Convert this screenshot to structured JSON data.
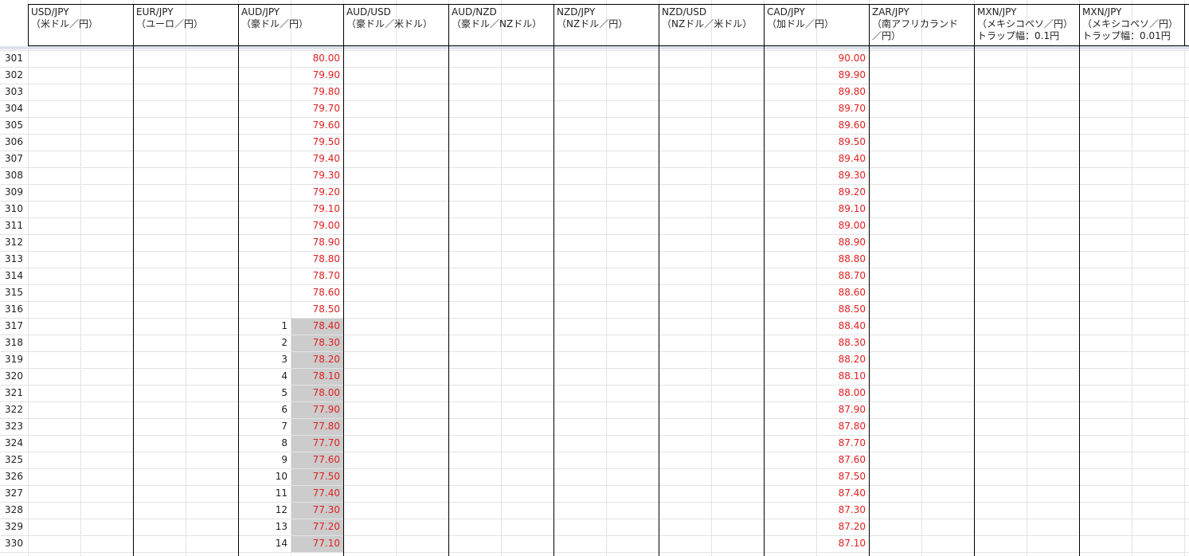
{
  "sheet": {
    "column_headers": [
      {
        "line1": "USD/JPY",
        "line2": "（米ドル／円）",
        "line3": ""
      },
      {
        "line1": "EUR/JPY",
        "line2": "（ユーロ／円）",
        "line3": ""
      },
      {
        "line1": "AUD/JPY",
        "line2": "（豪ドル／円）",
        "line3": ""
      },
      {
        "line1": "AUD/USD",
        "line2": "（豪ドル／米ドル）",
        "line3": ""
      },
      {
        "line1": "AUD/NZD",
        "line2": "（豪ドル／NZドル）",
        "line3": ""
      },
      {
        "line1": "NZD/JPY",
        "line2": "（NZドル／円）",
        "line3": ""
      },
      {
        "line1": "NZD/USD",
        "line2": "（NZドル／米ドル）",
        "line3": ""
      },
      {
        "line1": "CAD/JPY",
        "line2": "（加ドル／円）",
        "line3": ""
      },
      {
        "line1": "ZAR/JPY",
        "line2": "（南アフリカランド",
        "line3": "／円）"
      },
      {
        "line1": "MXN/JPY",
        "line2": "（メキシコペソ／円）",
        "line3": "トラップ幅：0.1円"
      },
      {
        "line1": "MXN/JPY",
        "line2": "（メキシコペソ／円）",
        "line3": "トラップ幅：0.01円"
      }
    ],
    "rows": [
      {
        "num": "301",
        "aud_idx": "",
        "aud_val": "80.00",
        "cad_val": "90.00",
        "shaded": false
      },
      {
        "num": "302",
        "aud_idx": "",
        "aud_val": "79.90",
        "cad_val": "89.90",
        "shaded": false
      },
      {
        "num": "303",
        "aud_idx": "",
        "aud_val": "79.80",
        "cad_val": "89.80",
        "shaded": false
      },
      {
        "num": "304",
        "aud_idx": "",
        "aud_val": "79.70",
        "cad_val": "89.70",
        "shaded": false
      },
      {
        "num": "305",
        "aud_idx": "",
        "aud_val": "79.60",
        "cad_val": "89.60",
        "shaded": false
      },
      {
        "num": "306",
        "aud_idx": "",
        "aud_val": "79.50",
        "cad_val": "89.50",
        "shaded": false
      },
      {
        "num": "307",
        "aud_idx": "",
        "aud_val": "79.40",
        "cad_val": "89.40",
        "shaded": false
      },
      {
        "num": "308",
        "aud_idx": "",
        "aud_val": "79.30",
        "cad_val": "89.30",
        "shaded": false
      },
      {
        "num": "309",
        "aud_idx": "",
        "aud_val": "79.20",
        "cad_val": "89.20",
        "shaded": false
      },
      {
        "num": "310",
        "aud_idx": "",
        "aud_val": "79.10",
        "cad_val": "89.10",
        "shaded": false
      },
      {
        "num": "311",
        "aud_idx": "",
        "aud_val": "79.00",
        "cad_val": "89.00",
        "shaded": false
      },
      {
        "num": "312",
        "aud_idx": "",
        "aud_val": "78.90",
        "cad_val": "88.90",
        "shaded": false
      },
      {
        "num": "313",
        "aud_idx": "",
        "aud_val": "78.80",
        "cad_val": "88.80",
        "shaded": false
      },
      {
        "num": "314",
        "aud_idx": "",
        "aud_val": "78.70",
        "cad_val": "88.70",
        "shaded": false
      },
      {
        "num": "315",
        "aud_idx": "",
        "aud_val": "78.60",
        "cad_val": "88.60",
        "shaded": false
      },
      {
        "num": "316",
        "aud_idx": "",
        "aud_val": "78.50",
        "cad_val": "88.50",
        "shaded": false
      },
      {
        "num": "317",
        "aud_idx": "1",
        "aud_val": "78.40",
        "cad_val": "88.40",
        "shaded": true
      },
      {
        "num": "318",
        "aud_idx": "2",
        "aud_val": "78.30",
        "cad_val": "88.30",
        "shaded": true
      },
      {
        "num": "319",
        "aud_idx": "3",
        "aud_val": "78.20",
        "cad_val": "88.20",
        "shaded": true
      },
      {
        "num": "320",
        "aud_idx": "4",
        "aud_val": "78.10",
        "cad_val": "88.10",
        "shaded": true
      },
      {
        "num": "321",
        "aud_idx": "5",
        "aud_val": "78.00",
        "cad_val": "88.00",
        "shaded": true
      },
      {
        "num": "322",
        "aud_idx": "6",
        "aud_val": "77.90",
        "cad_val": "87.90",
        "shaded": true
      },
      {
        "num": "323",
        "aud_idx": "7",
        "aud_val": "77.80",
        "cad_val": "87.80",
        "shaded": true
      },
      {
        "num": "324",
        "aud_idx": "8",
        "aud_val": "77.70",
        "cad_val": "87.70",
        "shaded": true
      },
      {
        "num": "325",
        "aud_idx": "9",
        "aud_val": "77.60",
        "cad_val": "87.60",
        "shaded": true
      },
      {
        "num": "326",
        "aud_idx": "10",
        "aud_val": "77.50",
        "cad_val": "87.50",
        "shaded": true
      },
      {
        "num": "327",
        "aud_idx": "11",
        "aud_val": "77.40",
        "cad_val": "87.40",
        "shaded": true
      },
      {
        "num": "328",
        "aud_idx": "12",
        "aud_val": "77.30",
        "cad_val": "87.30",
        "shaded": true
      },
      {
        "num": "329",
        "aud_idx": "13",
        "aud_val": "77.20",
        "cad_val": "87.20",
        "shaded": true
      },
      {
        "num": "330",
        "aud_idx": "14",
        "aud_val": "77.10",
        "cad_val": "87.10",
        "shaded": true
      }
    ],
    "colors": {
      "value_text": "#e02020",
      "shaded_fill": "#cccccc",
      "gridline": "#e2e3e3",
      "border": "#000000"
    }
  }
}
